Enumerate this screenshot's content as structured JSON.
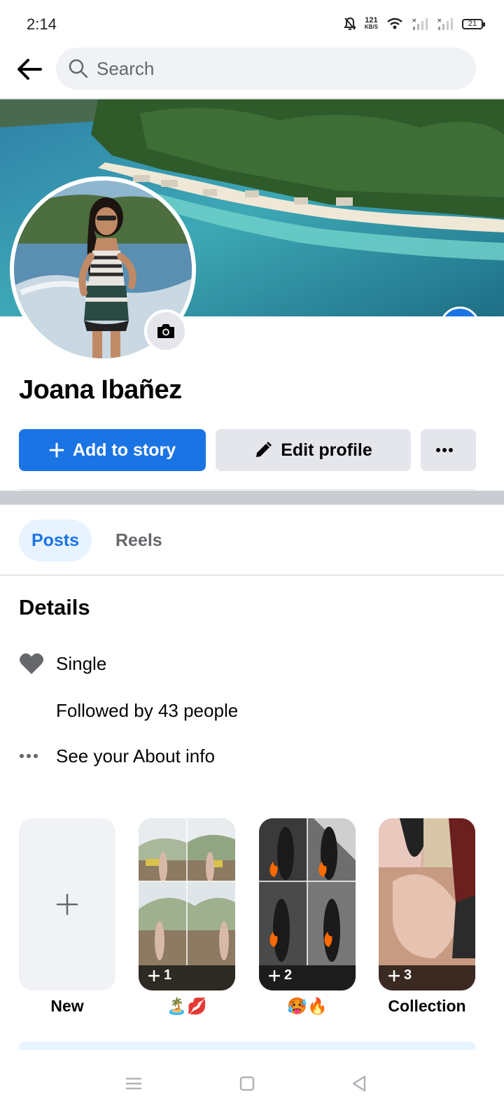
{
  "status_bar": {
    "time": "2:14",
    "speed_value": "121",
    "speed_unit": "KB/S",
    "battery": "21"
  },
  "search": {
    "placeholder": "Search"
  },
  "profile": {
    "name": "Joana Ibañez"
  },
  "actions": {
    "add_story_label": "Add to story",
    "edit_profile_label": "Edit profile"
  },
  "tabs": [
    {
      "label": "Posts",
      "active": true
    },
    {
      "label": "Reels",
      "active": false
    }
  ],
  "details": {
    "title": "Details",
    "relationship": "Single",
    "followers": "Followed by 43 people",
    "about": "See your About info"
  },
  "highlights": [
    {
      "label": "New",
      "count": ""
    },
    {
      "label": "🏝️💋",
      "count": "1"
    },
    {
      "label": "🥵🔥",
      "count": "2"
    },
    {
      "label": "Collection",
      "count": "3"
    }
  ],
  "colors": {
    "accent": "#1b74e4",
    "button_gray": "#e4e6eb",
    "tab_active_bg": "#e7f3ff",
    "secondary_text": "#65676b"
  }
}
